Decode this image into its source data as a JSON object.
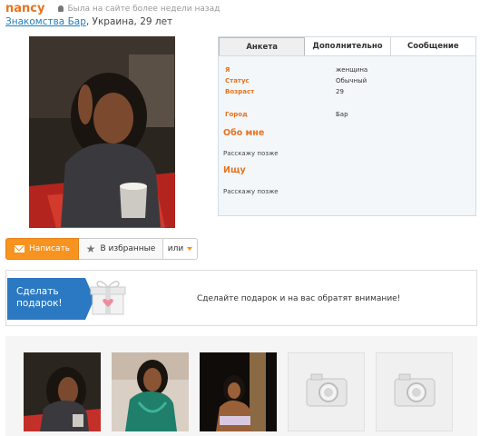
{
  "profile": {
    "username": "nancy",
    "status": "Была на сайте более недели назад",
    "site_link": "Знакомства Бар",
    "location": ", Украина, 29 лет"
  },
  "tabs": [
    "Анкета",
    "Дополнительно",
    "Сообщение"
  ],
  "fields": [
    {
      "label": "Я",
      "value": "женщина"
    },
    {
      "label": "Статус",
      "value": "Обычный"
    },
    {
      "label": "Возраст",
      "value": "29"
    },
    {
      "label": "Город",
      "value": "Бар"
    }
  ],
  "about": {
    "title": "Обо мне",
    "text": "Расскажу позже"
  },
  "seek": {
    "title": "Ищу",
    "text": "Расскажу позже"
  },
  "actions": {
    "write": "Написать",
    "favorite": "В избранные",
    "or": "или"
  },
  "gift": {
    "button": "Сделать\nподарок!",
    "text": "Сделайте подарок и на вас обратят внимание!"
  },
  "icons": [
    "lock-icon",
    "mail-icon",
    "star-icon",
    "caret-down-icon",
    "gift-icon",
    "camera-icon"
  ],
  "colors": {
    "accent": "#e8731e",
    "button": "#f7931e",
    "link": "#1f7dbf",
    "gift_button": "#2b79c2"
  }
}
